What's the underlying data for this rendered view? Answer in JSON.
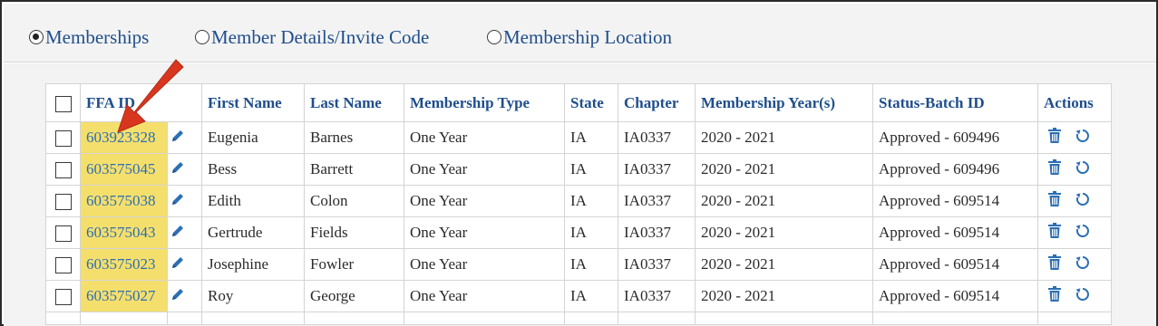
{
  "radio_options": [
    {
      "label": "Memberships",
      "selected": true
    },
    {
      "label": "Member Details/Invite Code",
      "selected": false
    },
    {
      "label": "Membership Location",
      "selected": false
    }
  ],
  "table": {
    "headers": {
      "ffa_id": "FFA ID",
      "first_name": "First Name",
      "last_name": "Last Name",
      "membership_type": "Membership Type",
      "state": "State",
      "chapter": "Chapter",
      "membership_years": "Membership Year(s)",
      "status_batch": "Status-Batch ID",
      "actions": "Actions"
    },
    "rows": [
      {
        "ffa_id": "603923328",
        "first_name": "Eugenia",
        "last_name": "Barnes",
        "membership_type": "One Year",
        "state": "IA",
        "chapter": "IA0337",
        "years": "2020 - 2021",
        "status": "Approved - 609496"
      },
      {
        "ffa_id": "603575045",
        "first_name": "Bess",
        "last_name": "Barrett",
        "membership_type": "One Year",
        "state": "IA",
        "chapter": "IA0337",
        "years": "2020 - 2021",
        "status": "Approved - 609496"
      },
      {
        "ffa_id": "603575038",
        "first_name": "Edith",
        "last_name": "Colon",
        "membership_type": "One Year",
        "state": "IA",
        "chapter": "IA0337",
        "years": "2020 - 2021",
        "status": "Approved - 609514"
      },
      {
        "ffa_id": "603575043",
        "first_name": "Gertrude",
        "last_name": "Fields",
        "membership_type": "One Year",
        "state": "IA",
        "chapter": "IA0337",
        "years": "2020 - 2021",
        "status": "Approved - 609514"
      },
      {
        "ffa_id": "603575023",
        "first_name": "Josephine",
        "last_name": "Fowler",
        "membership_type": "One Year",
        "state": "IA",
        "chapter": "IA0337",
        "years": "2020 - 2021",
        "status": "Approved - 609514"
      },
      {
        "ffa_id": "603575027",
        "first_name": "Roy",
        "last_name": "George",
        "membership_type": "One Year",
        "state": "IA",
        "chapter": "IA0337",
        "years": "2020 - 2021",
        "status": "Approved - 609514"
      }
    ]
  },
  "icons": {
    "edit": "pencil-icon",
    "delete": "trash-icon",
    "reset": "refresh-icon",
    "callout": "red-arrow-icon"
  },
  "colors": {
    "heading_blue": "#1f4e8c",
    "link_blue": "#2c6fb3",
    "highlight_yellow": "#f5df6c",
    "arrow_red": "#d9361f"
  }
}
